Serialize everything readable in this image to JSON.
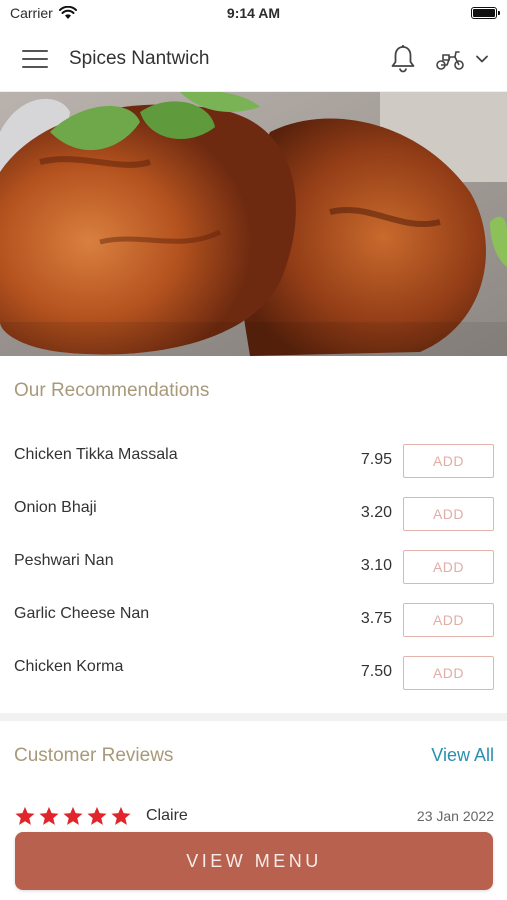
{
  "status_bar": {
    "carrier": "Carrier",
    "time": "9:14 AM"
  },
  "header": {
    "title": "Spices Nantwich",
    "icons": [
      "menu-icon",
      "bell-icon",
      "scooter-icon",
      "chevron-down-icon"
    ]
  },
  "hero": {
    "image": "tandoori-chicken-photo"
  },
  "recommendations": {
    "title": "Our Recommendations",
    "add_label": "ADD",
    "items": [
      {
        "name": "Chicken Tikka Massala",
        "price": "7.95"
      },
      {
        "name": "Onion Bhaji",
        "price": "3.20"
      },
      {
        "name": "Peshwari Nan",
        "price": "3.10"
      },
      {
        "name": "Garlic Cheese Nan",
        "price": "3.75"
      },
      {
        "name": "Chicken Korma",
        "price": "7.50"
      }
    ]
  },
  "reviews": {
    "title": "Customer Reviews",
    "view_all": "View All",
    "items": [
      {
        "reviewer": "Claire",
        "date": "23 Jan 2022",
        "rating": 5
      }
    ]
  },
  "cta": {
    "label": "VIEW MENU"
  },
  "colors": {
    "accent": "#b8614f",
    "section_title": "#a8997a",
    "add_border": "#e2b4ad",
    "link": "#2a8fb0",
    "star": "#e0262b"
  }
}
